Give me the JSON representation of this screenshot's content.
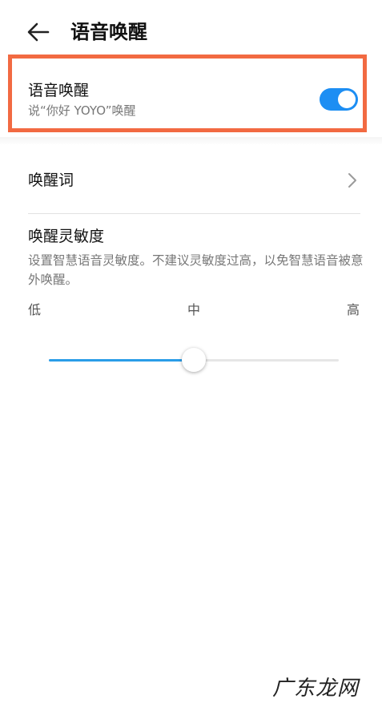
{
  "header": {
    "back_icon": "arrow-left-icon",
    "title": "语音唤醒"
  },
  "voice_wake": {
    "title": "语音唤醒",
    "subtitle": "说“你好 YOYO”唤醒",
    "enabled": true,
    "toggle_color": "#1d8ef3",
    "highlight_color": "#f26a42"
  },
  "wake_word": {
    "label": "唤醒词",
    "chevron_icon": "chevron-right-icon"
  },
  "sensitivity": {
    "title": "唤醒灵敏度",
    "description": "设置智慧语音灵敏度。不建议灵敏度过高，以免智慧语音被意外唤醒。",
    "low_label": "低",
    "mid_label": "中",
    "high_label": "高",
    "level": 0.5,
    "accent_color": "#2a9de8"
  },
  "watermark": "广东龙网"
}
